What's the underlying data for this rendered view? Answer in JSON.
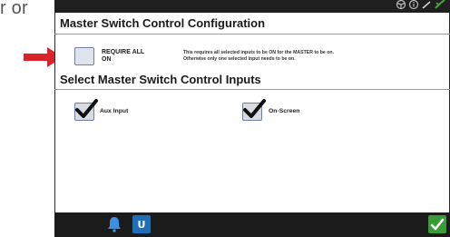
{
  "background_fragment": "r or",
  "config_section": {
    "title": "Master Switch Control Configuration",
    "require_all_label": "REQUIRE ALL\nON",
    "require_all_checked": false,
    "description_line1": "This requires all selected inputs to be ON for the MASTER to be on.",
    "description_line2": "Otherwise only one selected input needs to be on."
  },
  "inputs_section": {
    "title": "Select Master Switch Control Inputs",
    "options": [
      {
        "label": "Aux Input",
        "checked": true
      },
      {
        "label": "On-Screen",
        "checked": true
      }
    ]
  },
  "status_icons": [
    "steering-wheel-icon",
    "info-icon",
    "pen-icon",
    "satellite-icon"
  ],
  "bottom_bar": {
    "left_buttons": [
      "bell-icon",
      "ut-icon"
    ],
    "ut_label": "U",
    "confirm_icon": "checkmark-icon"
  },
  "colors": {
    "arrow": "#d9242b",
    "topbar": "#1f1f1f",
    "bottombar": "#1b1b1b",
    "confirm_button": "#3a9a36",
    "ut_button": "#1e6fb8",
    "checkbox_border": "#6f7ea3"
  }
}
